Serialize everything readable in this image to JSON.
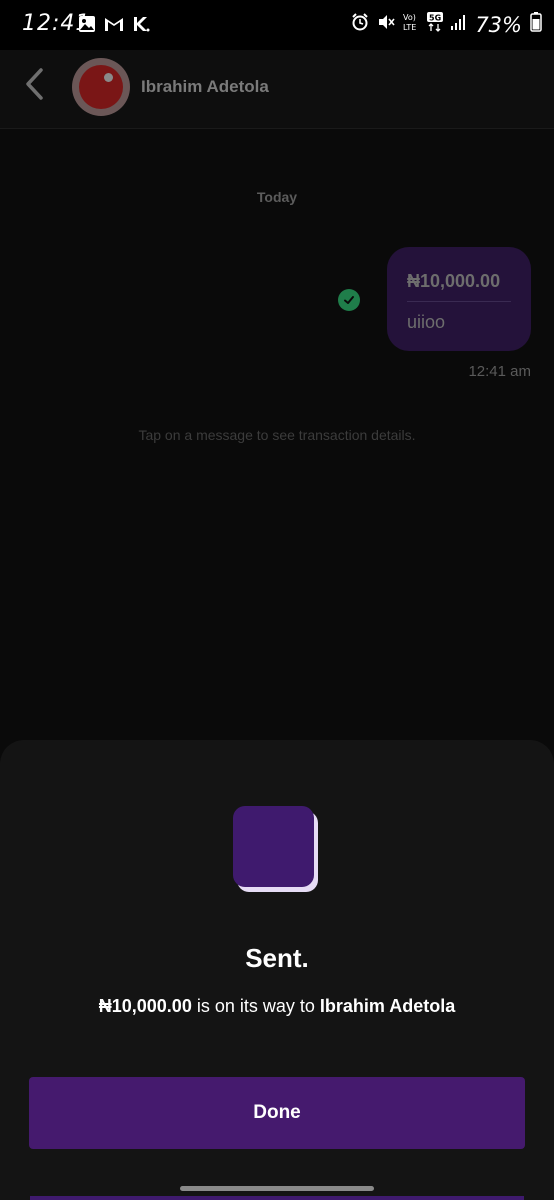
{
  "status_bar": {
    "time": "12:41",
    "battery": "73%",
    "left_icons": [
      "gallery-icon",
      "gmail-icon",
      "kuda-icon"
    ],
    "right_icons": [
      "alarm-icon",
      "mute-icon",
      "volte-icon",
      "5g-icon",
      "signal-icon",
      "battery-icon"
    ]
  },
  "header": {
    "contact_name": "Ibrahim Adetola"
  },
  "chat": {
    "date_separator": "Today",
    "message": {
      "amount": "₦10,000.00",
      "note": "uiioo",
      "time": "12:41 am"
    },
    "hint": "Tap on a message to see transaction details."
  },
  "sheet": {
    "title": "Sent.",
    "message_amount": "₦10,000.00",
    "message_middle": " is on its way to ",
    "message_recipient": "Ibrahim Adetola",
    "button_label": "Done"
  },
  "colors": {
    "accent": "#451a6e",
    "bubble": "#24123a",
    "success": "#1f7d4a",
    "sheet_bg": "#141414"
  }
}
